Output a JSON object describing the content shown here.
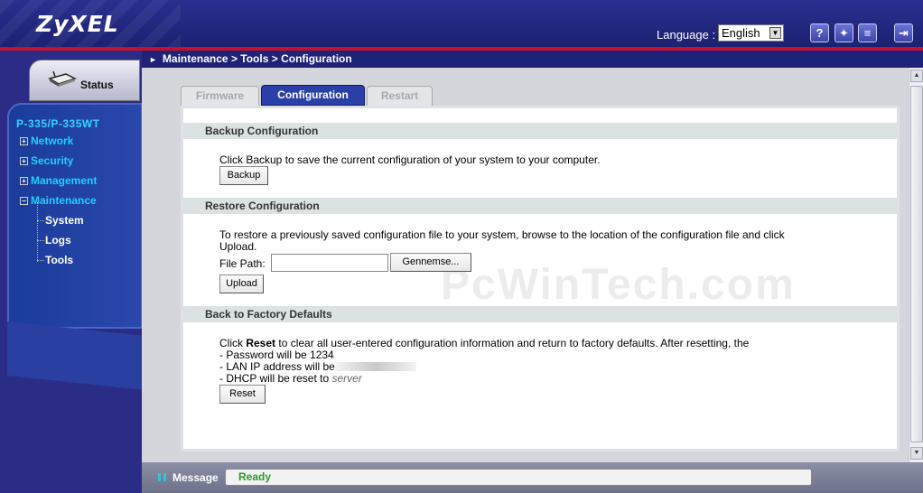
{
  "header": {
    "logo": "ZyXEL",
    "language_label": "Language :",
    "language_value": "English",
    "icons": [
      "help-icon",
      "wizard-icon",
      "notes-icon",
      "logout-icon"
    ]
  },
  "sidebar": {
    "status_label": "Status",
    "model": "P-335/P-335WT",
    "items": [
      {
        "label": "Network",
        "marker": "+"
      },
      {
        "label": "Security",
        "marker": "+"
      },
      {
        "label": "Management",
        "marker": "+"
      },
      {
        "label": "Maintenance",
        "marker": "−"
      }
    ],
    "subitems": [
      "System",
      "Logs",
      "Tools"
    ]
  },
  "breadcrumb": "Maintenance > Tools > Configuration",
  "tabs": [
    {
      "label": "Firmware",
      "active": false
    },
    {
      "label": "Configuration",
      "active": true
    },
    {
      "label": "Restart",
      "active": false
    }
  ],
  "backup": {
    "title": "Backup Configuration",
    "text": "Click Backup to save the current configuration of your system to your computer.",
    "button": "Backup"
  },
  "restore": {
    "title": "Restore Configuration",
    "text_line1": "To restore a previously saved configuration file to your system, browse to the location of the configuration file and click",
    "text_line2": "Upload.",
    "file_label": "File Path:",
    "file_value": "",
    "browse_button": "Gennemse...",
    "upload_button": "Upload"
  },
  "factory": {
    "title": "Back to Factory Defaults",
    "line1_pre": "Click ",
    "line1_bold": "Reset",
    "line1_post": " to clear all user-entered configuration information and return to factory defaults. After resetting, the",
    "line2": "- Password will be 1234",
    "line3": "- LAN IP address will be",
    "line4": "- DHCP will be reset to",
    "line4_value": "server",
    "button": "Reset"
  },
  "watermark": "PcWinTech.com",
  "message": {
    "label": "Message",
    "value": "Ready"
  },
  "colors": {
    "header_bg": "#2a2f8f",
    "accent_red": "#c8102e",
    "active_tab": "#2a3fa8",
    "nav_text": "#1fd0ff",
    "ready_green": "#2a9a2a"
  }
}
